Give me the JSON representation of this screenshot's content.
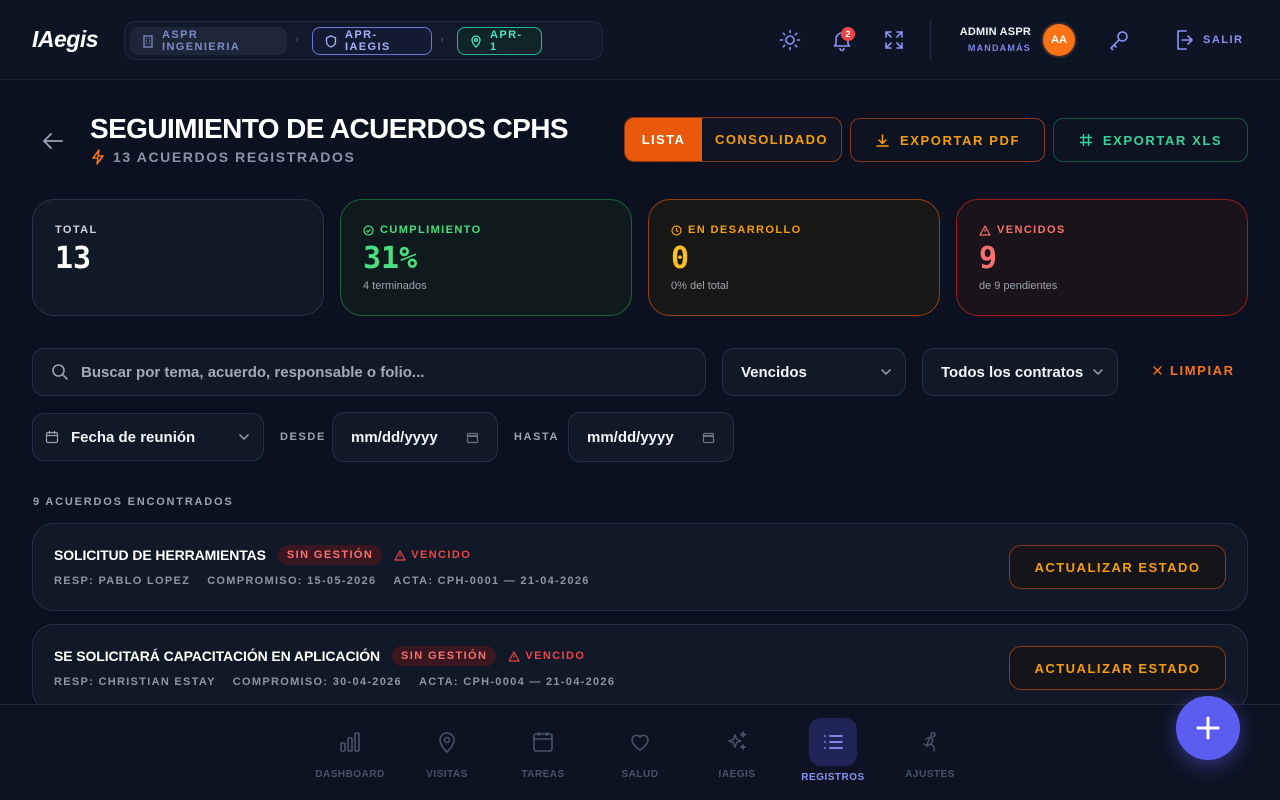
{
  "header": {
    "logo": "IAegis",
    "breadcrumb": [
      "ASPR INGENIERIA",
      "APR-IAEGIS",
      "APR-1"
    ],
    "notifications_count": "2",
    "user_name": "ADMIN ASPR",
    "user_role": "MANDAMÁS",
    "avatar_initials": "AA",
    "logout_label": "SALIR"
  },
  "page": {
    "title": "SEGUIMIENTO DE ACUERDOS CPHS",
    "subtitle": "13 ACUERDOS REGISTRADOS",
    "view_toggle": {
      "list": "LISTA",
      "consolidated": "CONSOLIDADO",
      "active": "list"
    },
    "export_pdf": "EXPORTAR PDF",
    "export_xls": "EXPORTAR XLS"
  },
  "stats": {
    "total": {
      "label": "TOTAL",
      "value": "13"
    },
    "compliance": {
      "label": "CUMPLIMIENTO",
      "value": "31%",
      "sub": "4 terminados"
    },
    "in_progress": {
      "label": "EN DESARROLLO",
      "value": "0",
      "sub": "0% del total"
    },
    "overdue": {
      "label": "VENCIDOS",
      "value": "9",
      "sub": "de 9 pendientes"
    }
  },
  "filters": {
    "search_placeholder": "Buscar por tema, acuerdo, responsable o folio...",
    "status": "Vencidos",
    "contract": "Todos los contratos",
    "clear": "LIMPIAR",
    "date_type": "Fecha de reunión",
    "from_label": "DESDE",
    "to_label": "HASTA",
    "from_value": "mm/dd/yyyy",
    "to_value": "mm/dd/yyyy"
  },
  "results": {
    "count_label": "9 ACUERDOS ENCONTRADOS",
    "items": [
      {
        "title": "SOLICITUD DE HERRAMIENTAS",
        "badge": "SIN GESTIÓN",
        "state": "VENCIDO",
        "resp": "RESP: PABLO LOPEZ",
        "commit": "COMPROMISO: 15-05-2026",
        "acta": "ACTA: CPH-0001 — 21-04-2026",
        "action": "ACTUALIZAR ESTADO"
      },
      {
        "title": "SE SOLICITARÁ CAPACITACIÓN EN APLICACIÓN",
        "badge": "SIN GESTIÓN",
        "state": "VENCIDO",
        "resp": "RESP: CHRISTIAN ESTAY",
        "commit": "COMPROMISO: 30-04-2026",
        "acta": "ACTA: CPH-0004 — 21-04-2026",
        "action": "ACTUALIZAR ESTADO"
      }
    ]
  },
  "nav": [
    "DASHBOARD",
    "VISITAS",
    "TAREAS",
    "SALUD",
    "IAEGIS",
    "REGISTROS",
    "AJUSTES"
  ],
  "nav_active": "REGISTROS",
  "colors": {
    "background": "#0b1120",
    "accent_orange": "#ea580c",
    "accent_indigo": "#5b5cf0",
    "success": "#34d399",
    "warning": "#f59e0b",
    "danger": "#ef4444"
  }
}
